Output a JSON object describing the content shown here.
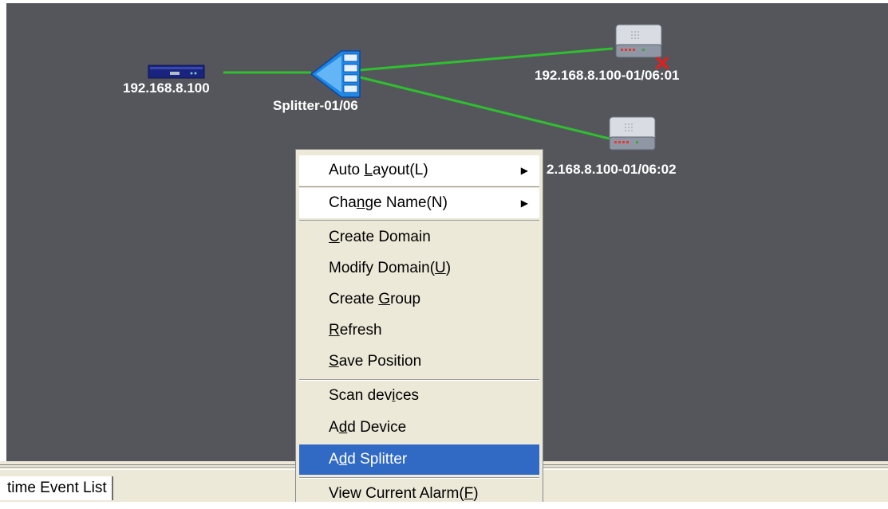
{
  "topology": {
    "nodes": [
      {
        "label": "192.168.8.100",
        "icon": "olt-rack-icon"
      },
      {
        "label": "Splitter-01/06",
        "icon": "splitter-icon"
      },
      {
        "label": "192.168.8.100-01/06:01",
        "icon": "onu-icon",
        "status": "alarm"
      },
      {
        "label": "2.168.8.100-01/06:02",
        "icon": "onu-icon"
      }
    ],
    "link_color": "#2fbf2f",
    "alarm_color": "#e02020"
  },
  "context_menu": {
    "items": [
      {
        "pre": "Auto ",
        "key": "L",
        "post": "ayout(L)",
        "submenu": true
      },
      {
        "pre": "Cha",
        "key": "n",
        "post": "ge Name(N)",
        "submenu": true
      },
      {
        "pre": "",
        "key": "C",
        "post": "reate Domain"
      },
      {
        "pre": "Modify Domain(",
        "key": "U",
        "post": ")"
      },
      {
        "pre": "Create ",
        "key": "G",
        "post": "roup"
      },
      {
        "pre": "",
        "key": "R",
        "post": "efresh"
      },
      {
        "pre": "",
        "key": "S",
        "post": "ave Position"
      },
      {
        "pre": "Scan dev",
        "key": "i",
        "post": "ces"
      },
      {
        "pre": "A",
        "key": "d",
        "post": "d Device"
      },
      {
        "pre": "A",
        "key": "d",
        "post": "d Splitter",
        "selected": true
      },
      {
        "pre": "View Current Alarm(",
        "key": "F",
        "post": ")"
      }
    ]
  },
  "bottom_tab": {
    "label": "time Event List"
  },
  "colors": {
    "canvas_bg": "#55565c",
    "menu_bg": "#ece9d8",
    "selection": "#316ac5"
  }
}
